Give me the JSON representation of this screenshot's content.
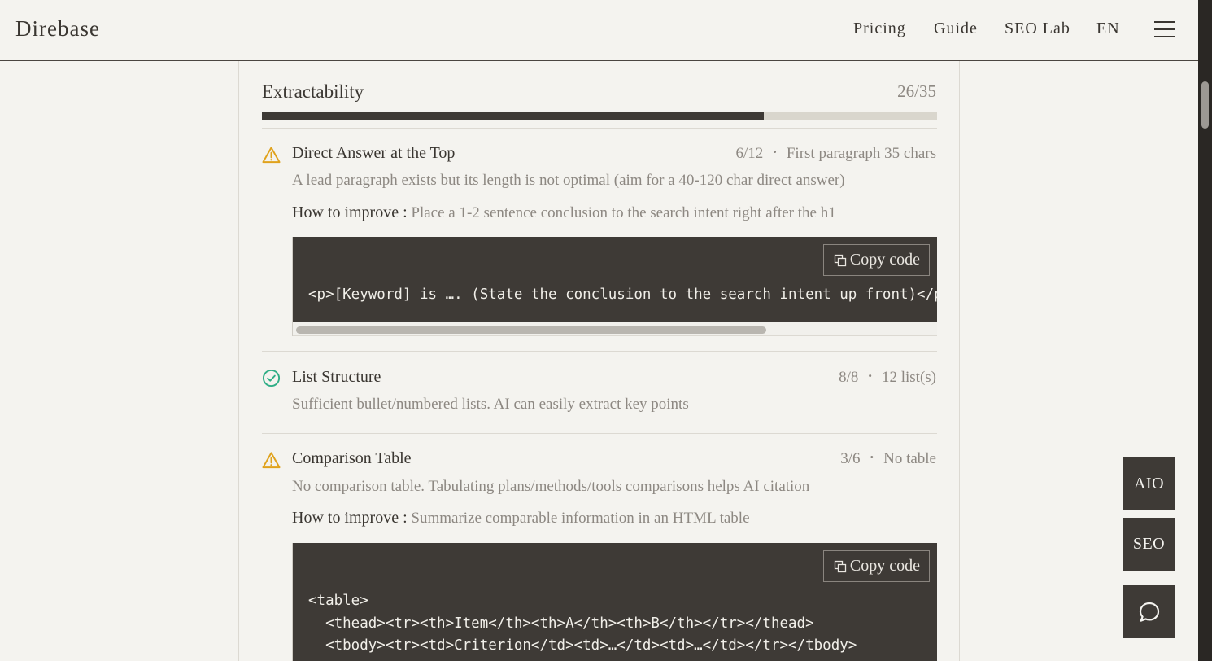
{
  "header": {
    "brand": "Direbase",
    "nav": [
      "Pricing",
      "Guide",
      "SEO Lab",
      "EN"
    ]
  },
  "section": {
    "title": "Extractability",
    "score": "26/35",
    "progress_fraction": 0.7429
  },
  "items": [
    {
      "status": "warning",
      "title": "Direct Answer at the Top",
      "score": "6/12",
      "detail": "First paragraph 35 chars",
      "description": "A lead paragraph exists but its length is not optimal (aim for a 40-120 char direct answer)",
      "improve_label": "How to improve :",
      "improve_text": "Place a 1-2 sentence conclusion to the search intent right after the h1",
      "copy_label": "Copy code",
      "code": [
        "<p>[Keyword] is …. (State the conclusion to the search intent up front)</p>"
      ]
    },
    {
      "status": "ok",
      "title": "List Structure",
      "score": "8/8",
      "detail": "12 list(s)",
      "description": "Sufficient bullet/numbered lists. AI can easily extract key points"
    },
    {
      "status": "warning",
      "title": "Comparison Table",
      "score": "3/6",
      "detail": "No table",
      "description": "No comparison table. Tabulating plans/methods/tools comparisons helps AI citation",
      "improve_label": "How to improve :",
      "improve_text": "Summarize comparable information in an HTML table",
      "copy_label": "Copy code",
      "code": [
        "<table>",
        "  <thead><tr><th>Item</th><th>A</th><th>B</th></tr></thead>",
        "  <tbody><tr><td>Criterion</td><td>…</td><td>…</td></tr></tbody>"
      ]
    }
  ],
  "fabs": {
    "aio": "AIO",
    "seo": "SEO",
    "chat_icon": "chat-bubble-icon"
  },
  "colors": {
    "warning": "#e0a21c",
    "ok": "#2fae86",
    "dark": "#3e3a36",
    "muted": "#8d8882"
  }
}
